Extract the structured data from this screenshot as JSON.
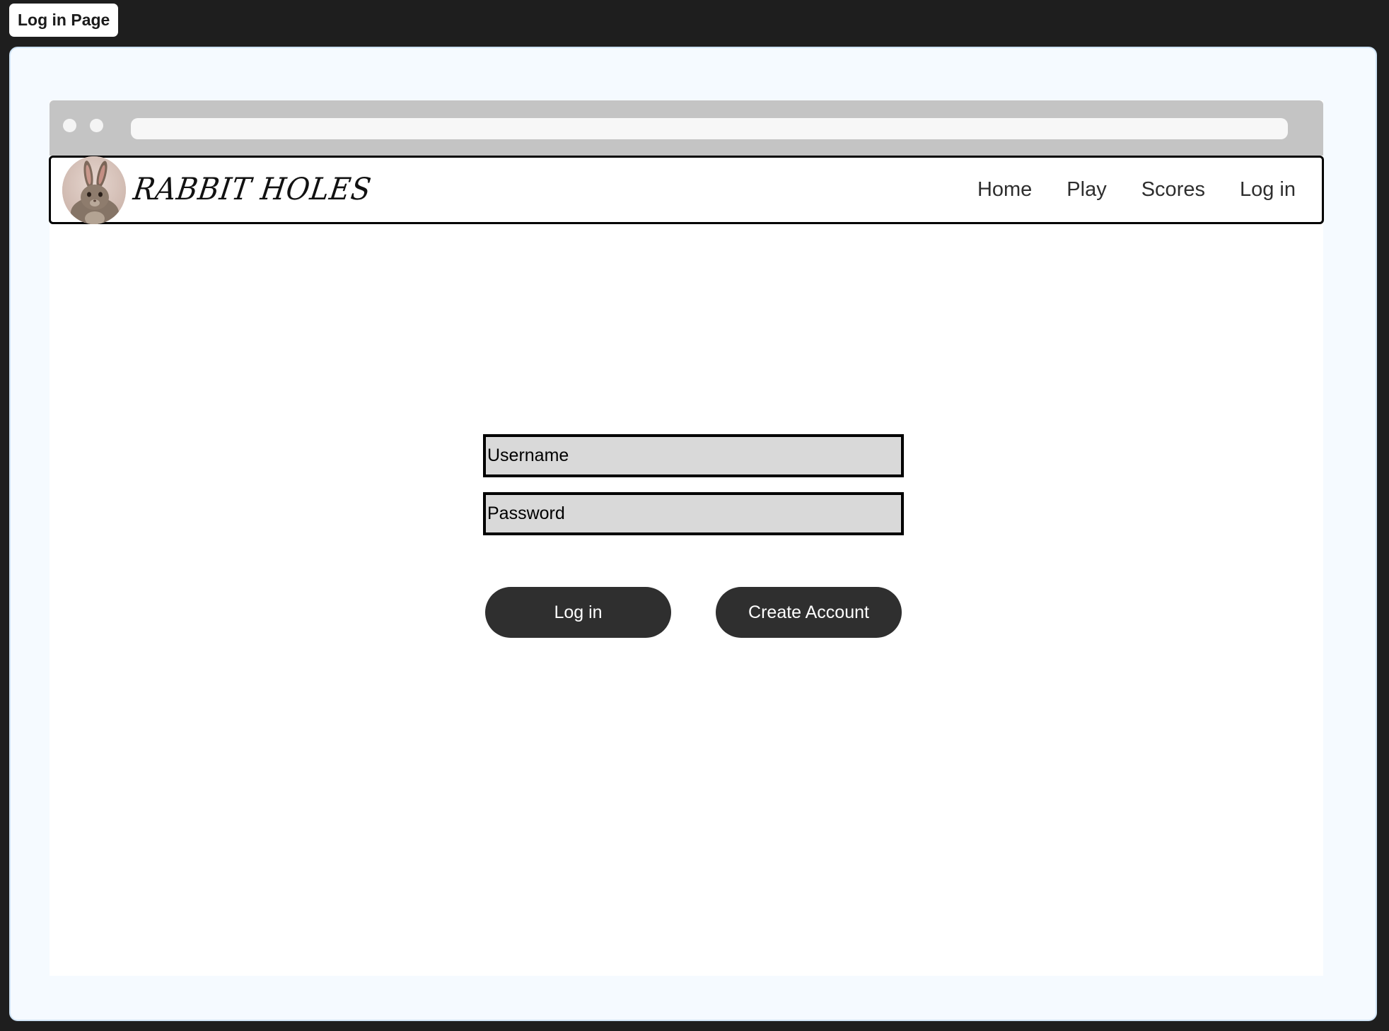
{
  "frame": {
    "tab_label": "Log in Page"
  },
  "site": {
    "logo_text": "RABBIT HOLES",
    "nav": [
      "Home",
      "Play",
      "Scores",
      "Log in"
    ]
  },
  "form": {
    "username_placeholder": "Username",
    "password_placeholder": "Password",
    "login_button": "Log in",
    "create_account_button": "Create Account"
  },
  "colors": {
    "page_background": "#1e1e1e",
    "frame_background": "#f5faff",
    "browser_chrome": "#c4c4c4",
    "input_fill": "#d9d9d9",
    "button_fill": "#2f2f2f",
    "button_text": "#ffffff"
  }
}
